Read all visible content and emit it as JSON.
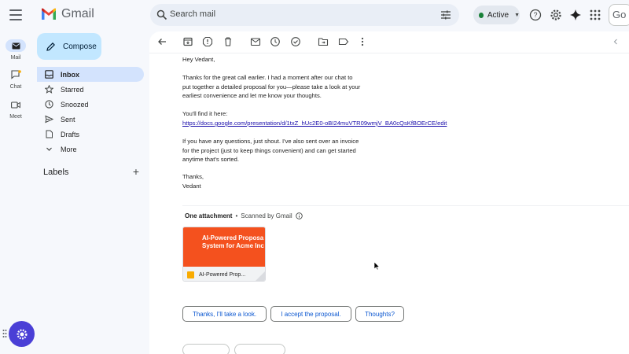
{
  "app": {
    "name": "Gmail"
  },
  "search": {
    "placeholder": "Search mail"
  },
  "status": {
    "label": "Active",
    "color": "#188038"
  },
  "account": {
    "label": "Go"
  },
  "rail": [
    {
      "label": "Mail",
      "icon": "mail-icon"
    },
    {
      "label": "Chat",
      "icon": "chat-icon"
    },
    {
      "label": "Meet",
      "icon": "meet-icon"
    }
  ],
  "compose": {
    "label": "Compose"
  },
  "nav": [
    {
      "label": "Inbox",
      "icon": "inbox-icon",
      "active": true
    },
    {
      "label": "Starred",
      "icon": "star-icon"
    },
    {
      "label": "Snoozed",
      "icon": "clock-icon"
    },
    {
      "label": "Sent",
      "icon": "send-icon"
    },
    {
      "label": "Drafts",
      "icon": "draft-icon"
    },
    {
      "label": "More",
      "icon": "chevron-down-icon"
    }
  ],
  "labels": {
    "title": "Labels",
    "add": "+"
  },
  "email": {
    "greeting": "Hey Vedant,",
    "para1": [
      "Thanks for the great call earlier. I had a moment after our chat to",
      "put together a detailed proposal for you—please take a look at your",
      "earliest convenience and let me know your thoughts."
    ],
    "find_it": "You'll find it here:",
    "link": "https://docs.google.com/presentation/d/1txZ_hUc2E0-oBI24muVTR09wmjV_BA0cQsKfBOErCE/edit",
    "para2": [
      "If you have any questions, just shout. I've also sent over an invoice",
      "for the project (just to keep things convenient) and can get started",
      "anytime that's sorted."
    ],
    "signoff": "Thanks,",
    "signature": "Vedant"
  },
  "attachment": {
    "header_bold": "One attachment",
    "header_sep": "•",
    "scanned": "Scanned by Gmail",
    "thumb_title_line1": "AI-Powered Proposa",
    "thumb_title_line2": "System for Acme Inc",
    "file_name": "AI-Powered Prop...",
    "accent": "#f4511e"
  },
  "smart_replies": [
    "Thanks, I'll take a look.",
    "I accept the proposal.",
    "Thoughts?"
  ],
  "colors": {
    "bg": "#f6f8fc",
    "active_nav": "#d3e3fd",
    "compose": "#c2e7ff",
    "link": "#1a0dab",
    "chip_text": "#0b57d0"
  }
}
